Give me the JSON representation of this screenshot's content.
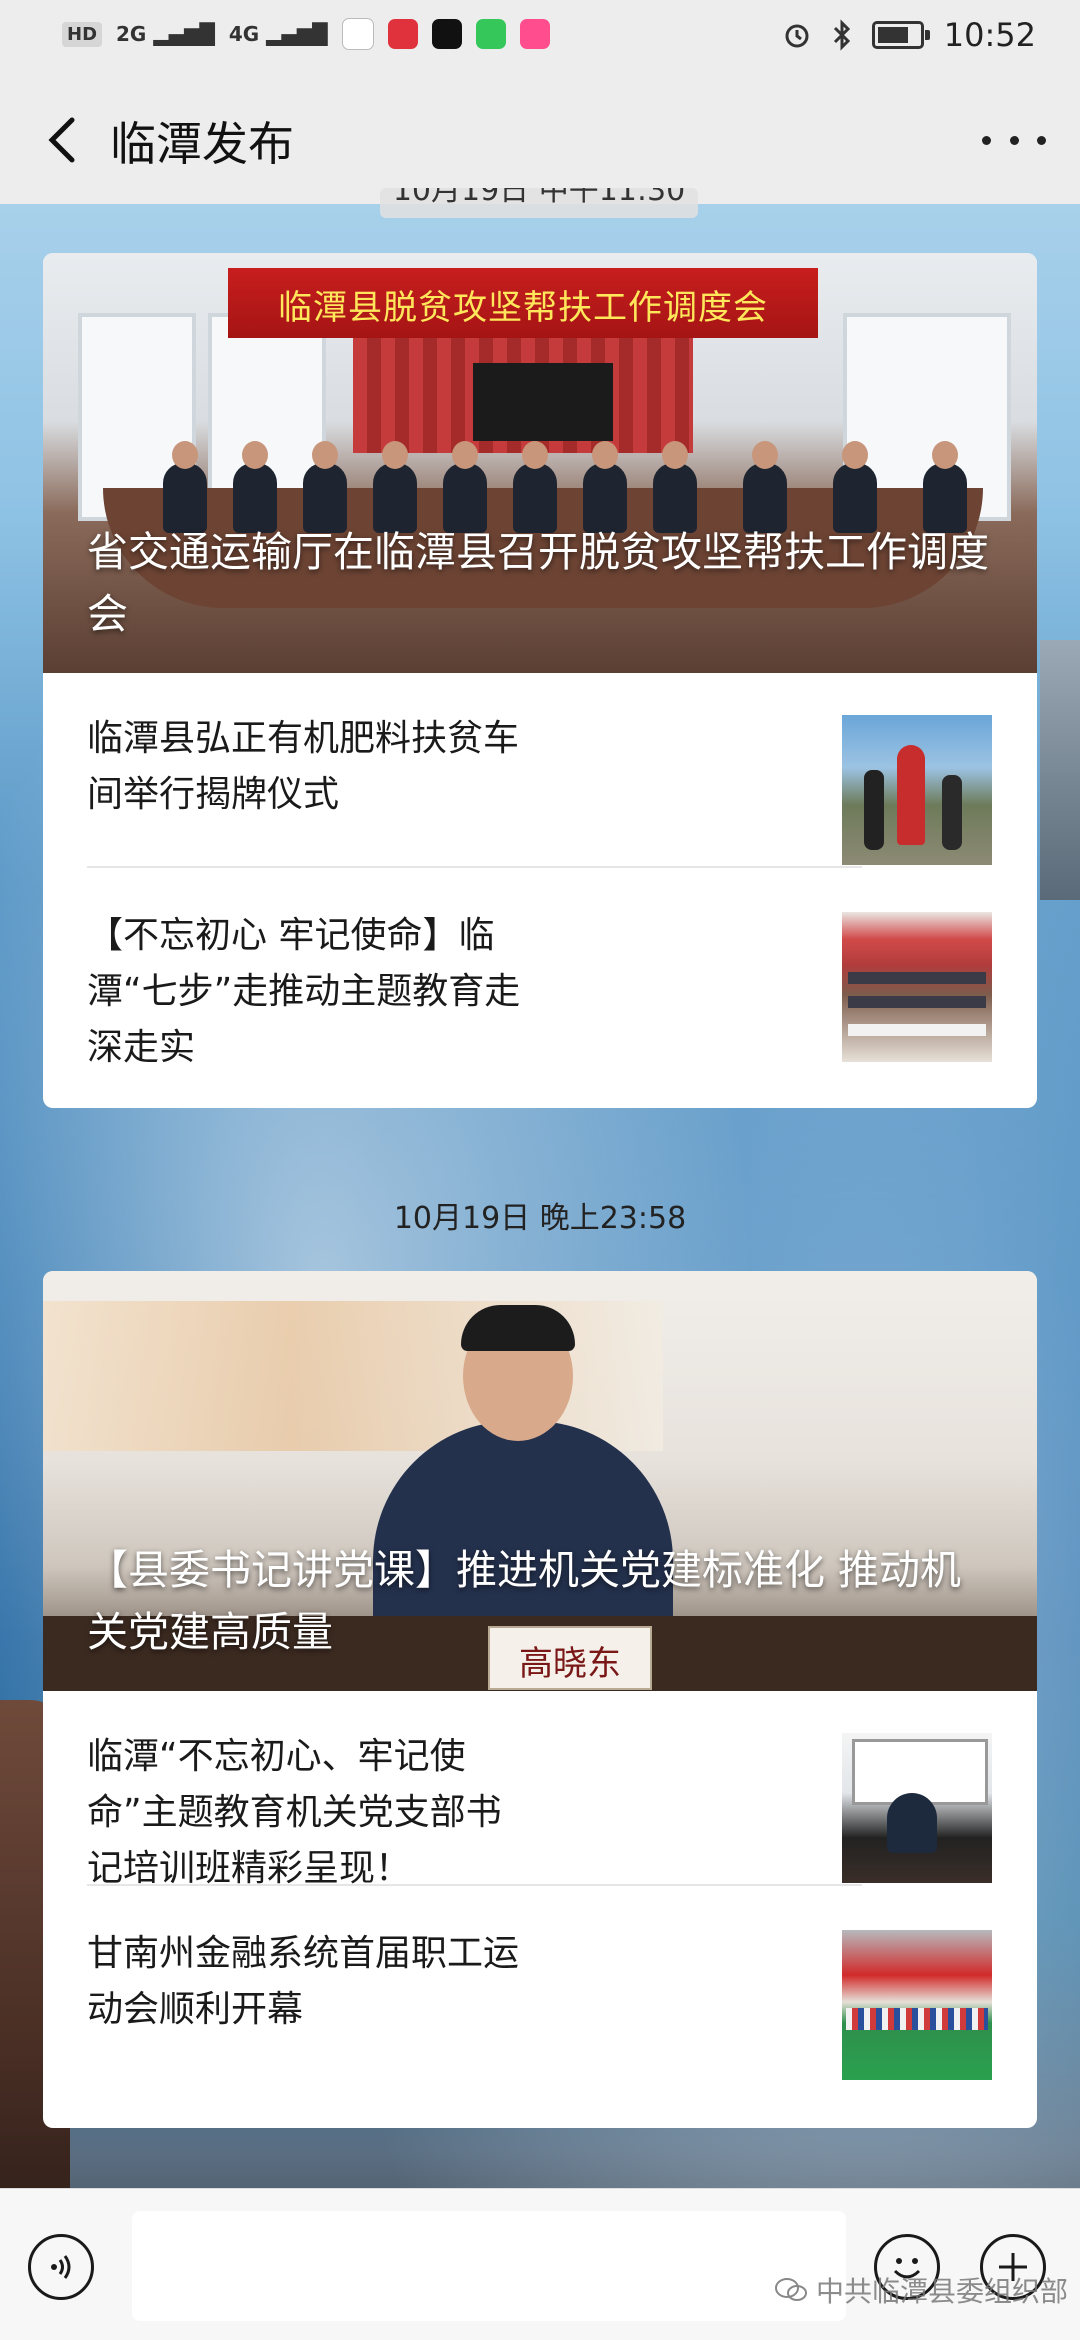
{
  "status_bar": {
    "hd_label": "HD",
    "signal_1": "2G",
    "signal_2": "4G",
    "time": "10:52",
    "alarm_icon": "alarm-icon",
    "bluetooth_icon": "bluetooth-icon",
    "battery_icon": "battery-icon"
  },
  "header": {
    "title": "临潭发布",
    "back_icon": "chevron-left-icon",
    "more_icon": "more-dots-icon"
  },
  "messages": [
    {
      "time": "10月19日 中午11:30",
      "hero": {
        "title": "省交通运输厅在临潭县召开脱贫攻坚帮扶工作调度会",
        "banner_text": "临潭县脱贫攻坚帮扶工作调度会"
      },
      "items": [
        {
          "title": "临潭县弘正有机肥料扶贫车间举行揭牌仪式"
        },
        {
          "title": "【不忘初心 牢记使命】临潭“七步”走推动主题教育走深走实"
        }
      ]
    },
    {
      "time": "10月19日 晚上23:58",
      "hero": {
        "title": "【县委书记讲党课】推进机关党建标准化 推动机关党建高质量",
        "nameplate_text": "高晓东"
      },
      "items": [
        {
          "title": "临潭“不忘初心、牢记使命”主题教育机关党支部书记培训班精彩呈现！"
        },
        {
          "title": "甘南州金融系统首届职工运动会顺利开幕"
        }
      ]
    }
  ],
  "input_bar": {
    "voice_icon": "voice-icon",
    "emoji_icon": "emoji-icon",
    "plus_icon": "plus-icon",
    "watermark": "中共临潭县委组织部"
  },
  "colors": {
    "header_bg": "#ededed",
    "card_bg": "#ffffff",
    "text": "#1a1a1a"
  }
}
